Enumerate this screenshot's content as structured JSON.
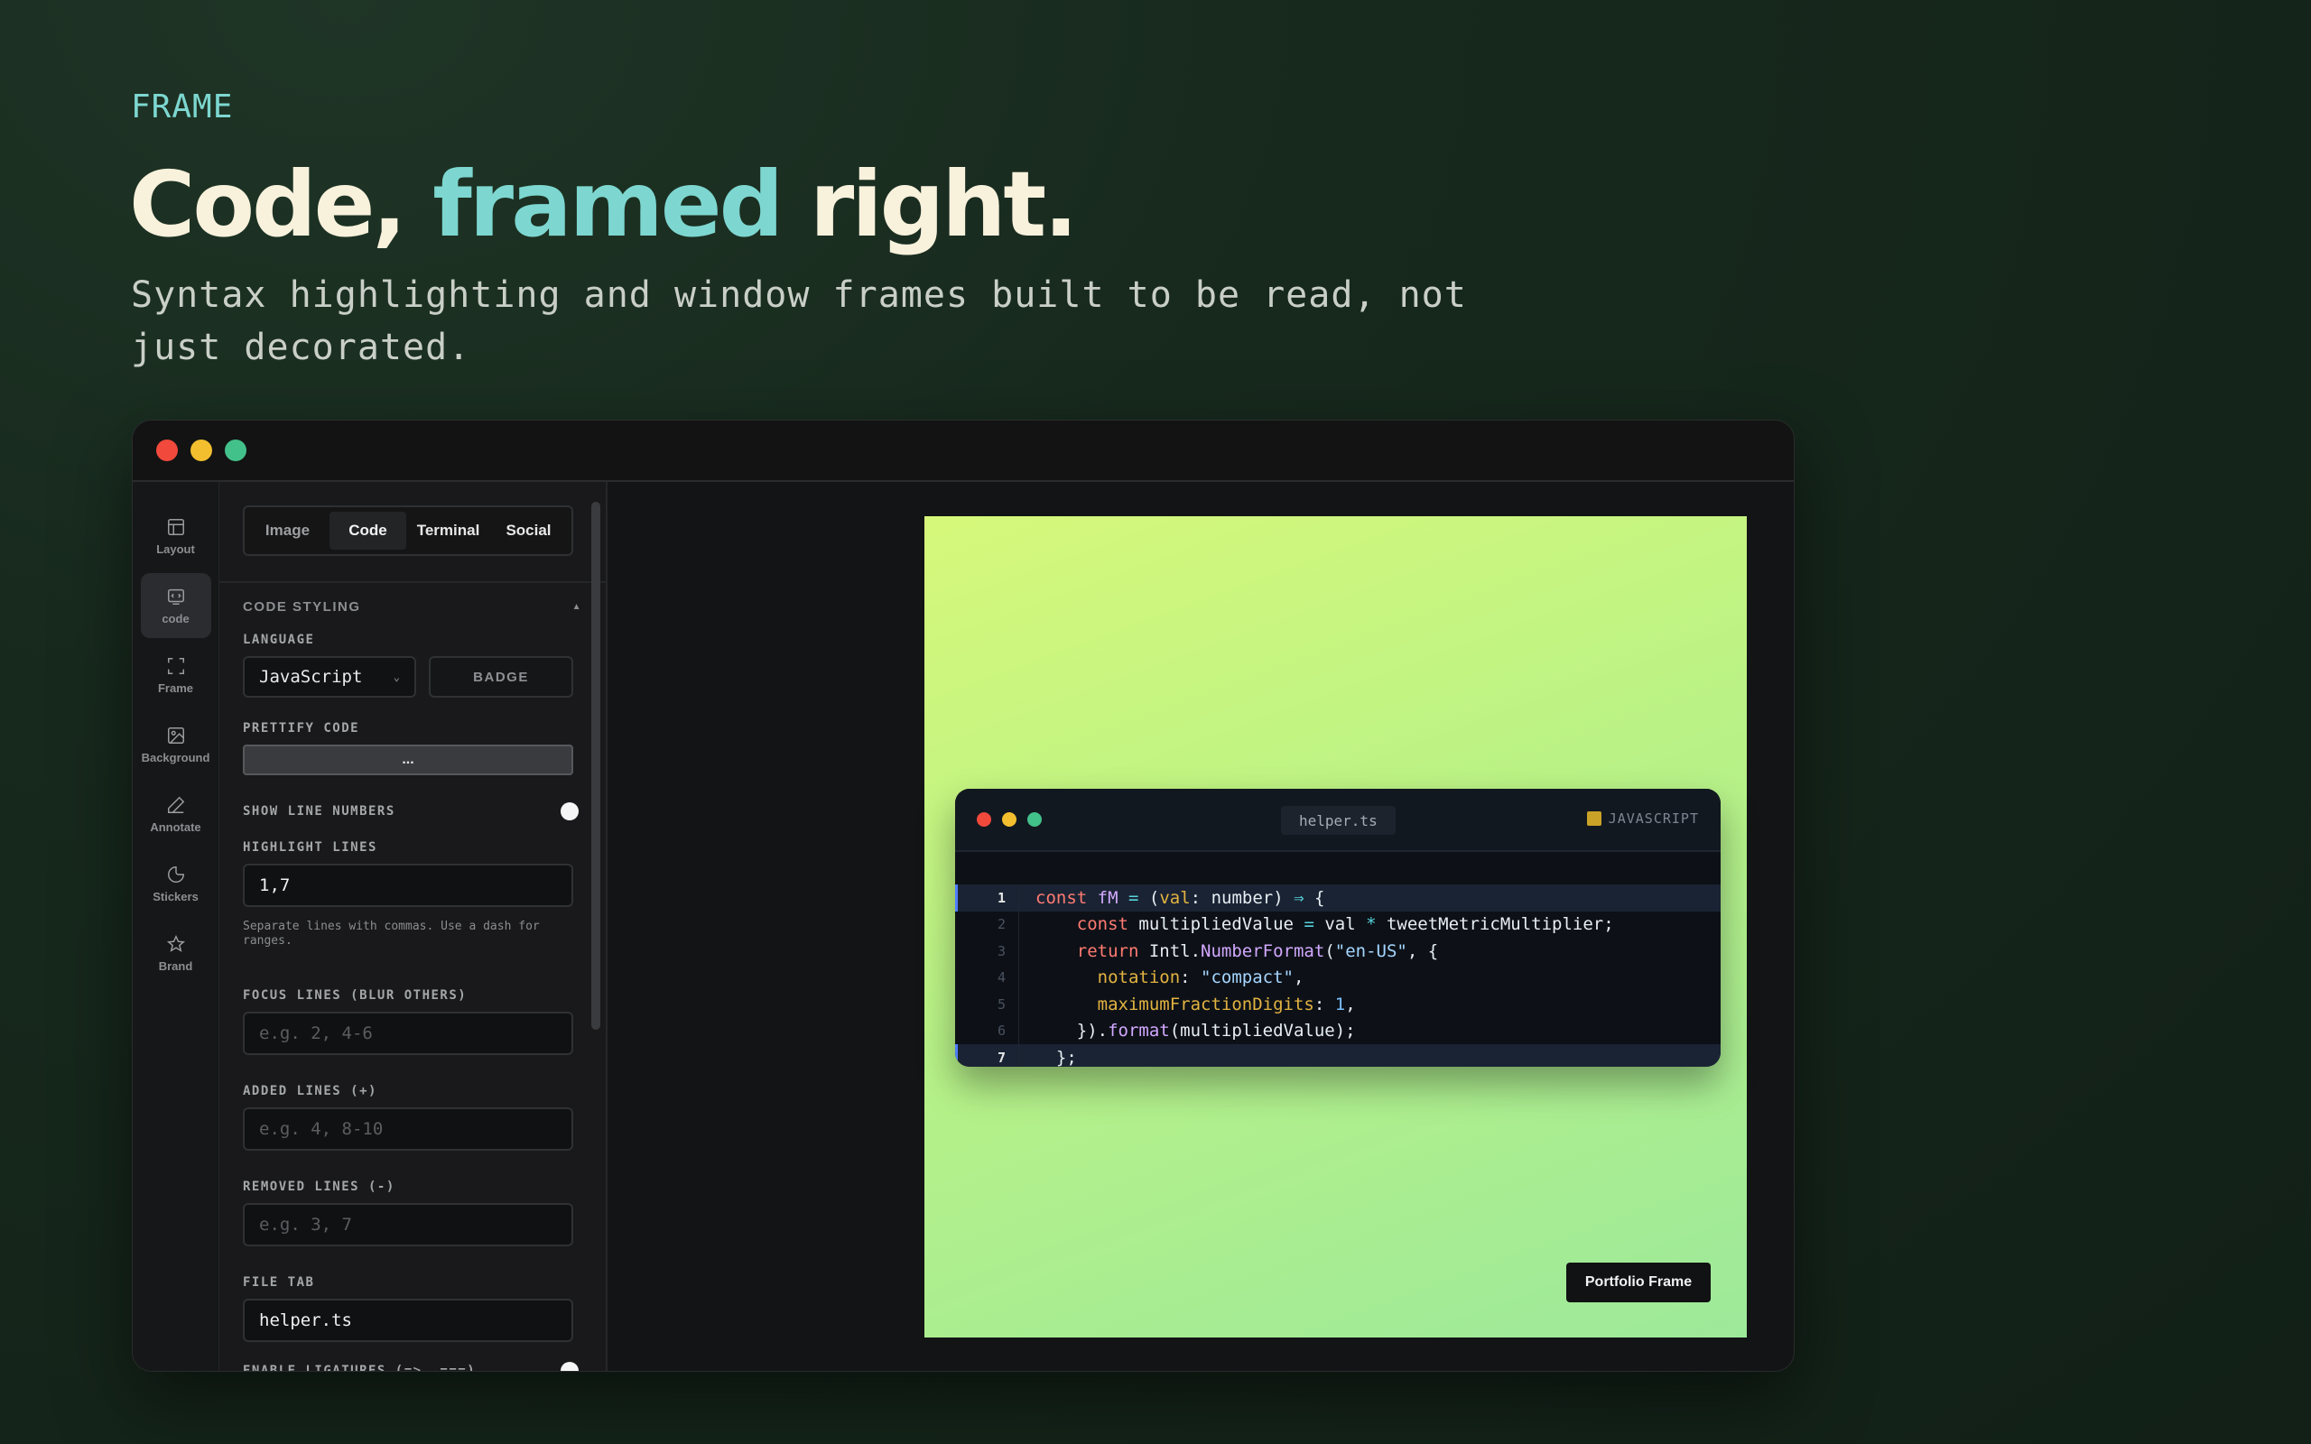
{
  "hero": {
    "eyebrow": "FRAME",
    "headline_part1": "Code, ",
    "headline_accent": "framed",
    "headline_part2": " right.",
    "subhead": "Syntax highlighting and window frames built to be read, not just decorated."
  },
  "rail": [
    {
      "label": "Layout",
      "icon": "layout-icon"
    },
    {
      "label": "code",
      "icon": "code-icon",
      "active": true
    },
    {
      "label": "Frame",
      "icon": "frame-icon"
    },
    {
      "label": "Background",
      "icon": "image-icon"
    },
    {
      "label": "Annotate",
      "icon": "pen-icon"
    },
    {
      "label": "Stickers",
      "icon": "sticker-icon"
    },
    {
      "label": "Brand",
      "icon": "star-icon"
    }
  ],
  "tabs": [
    "Image",
    "Code",
    "Terminal",
    "Social"
  ],
  "panel": {
    "section_title": "CODE STYLING",
    "collapse_glyph": "▲",
    "language_label": "LANGUAGE",
    "language_value": "JavaScript",
    "badge_label": "BADGE",
    "prettify_label": "PRETTIFY CODE",
    "prettify_button": "...",
    "show_line_numbers_label": "SHOW LINE NUMBERS",
    "highlight_lines_label": "HIGHLIGHT LINES",
    "highlight_lines_value": "1,7",
    "highlight_hint": "Separate lines with commas. Use a dash for ranges.",
    "focus_lines_label": "FOCUS LINES (BLUR OTHERS)",
    "focus_lines_placeholder": "e.g. 2, 4-6",
    "added_lines_label": "ADDED LINES (+)",
    "added_lines_placeholder": "e.g. 4, 8-10",
    "removed_lines_label": "REMOVED LINES (-)",
    "removed_lines_placeholder": "e.g. 3, 7",
    "file_tab_label": "FILE TAB",
    "file_tab_value": "helper.ts",
    "ligatures_label": "ENABLE LIGATURES (=>, ===)"
  },
  "preview": {
    "file_tab": "helper.ts",
    "language_badge": "JAVASCRIPT",
    "line_numbers": [
      "1",
      "2",
      "3",
      "4",
      "5",
      "6",
      "7"
    ],
    "portfolio_label": "Portfolio Frame"
  },
  "colors": {
    "accent": "#7dd7d0",
    "headline": "#f8f1dc",
    "artboard_start": "#d6f87a",
    "artboard_end": "#9de99a"
  }
}
